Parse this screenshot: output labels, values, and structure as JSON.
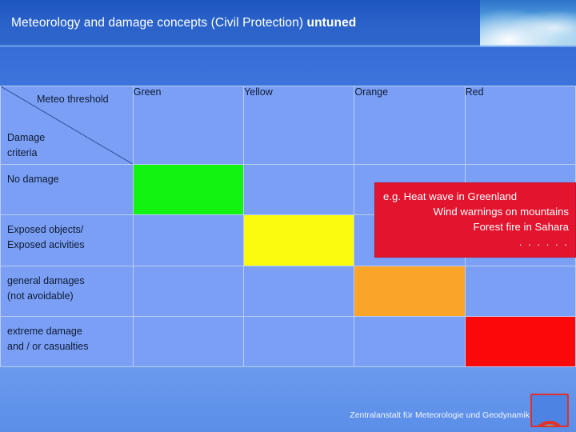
{
  "title": {
    "normal": "Meteorology and damage concepts (Civil Protection) ",
    "bold": "untuned"
  },
  "matrix": {
    "corner": {
      "meteo_threshold": "Meteo threshold",
      "damage_criteria_line1": "Damage",
      "damage_criteria_line2": "criteria"
    },
    "columns": [
      {
        "label": "Green",
        "color": "#12f312"
      },
      {
        "label": "Yellow",
        "color": "#fbfb10"
      },
      {
        "label": "Orange",
        "color": "#fba42a"
      },
      {
        "label": "Red",
        "color": "#fd0808"
      }
    ],
    "rows": [
      {
        "label_line1": "No damage",
        "label_line2": ""
      },
      {
        "label_line1": "Exposed objects/",
        "label_line2": "Exposed acivities"
      },
      {
        "label_line1": "general damages",
        "label_line2": "(not avoidable)"
      },
      {
        "label_line1": "extreme damage",
        "label_line2": "and / or casualties"
      }
    ],
    "cell_blue_color": "#7b9ff5"
  },
  "callout": {
    "line1": "e.g. Heat wave in Greenland",
    "line2": "Wind warnings on mountains",
    "line3": "Forest fire in Sahara",
    "line4": ". . . . . .",
    "background": "#e3142e"
  },
  "footer": {
    "organization": "Zentralanstalt für Meteorologie und Geodynamik"
  }
}
